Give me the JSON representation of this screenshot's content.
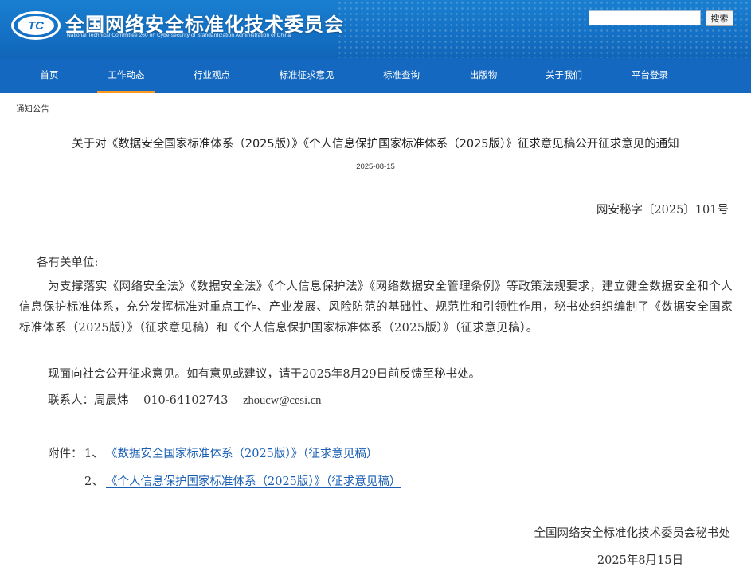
{
  "header": {
    "logo_text": "TC",
    "site_title": "全国网络安全标准化技术委员会",
    "site_subtitle": "National Technical Committee 260 on Cybersecurity of Standardization Administration of China",
    "search_placeholder": "",
    "search_button": "搜索"
  },
  "nav": {
    "items": [
      {
        "label": "首页"
      },
      {
        "label": "工作动态",
        "active": true
      },
      {
        "label": "行业观点"
      },
      {
        "label": "标准征求意见"
      },
      {
        "label": "标准查询"
      },
      {
        "label": "出版物"
      },
      {
        "label": "关于我们"
      },
      {
        "label": "平台登录"
      }
    ],
    "active_color": "#ff9a1e"
  },
  "breadcrumb": "通知公告",
  "article": {
    "title": "关于对《数据安全国家标准体系（2025版）》《个人信息保护国家标准体系（2025版）》征求意见稿公开征求意见的通知",
    "date": "2025-08-15",
    "doc_number": "网安秘字〔2025〕101号",
    "salutation": "各有关单位:",
    "paragraph1": "为支撑落实《网络安全法》《数据安全法》《个人信息保护法》《网络数据安全管理条例》等政策法规要求，建立健全数据安全和个人信息保护标准体系，充分发挥标准对重点工作、产业发展、风险防范的基础性、规范性和引领性作用，秘书处组织编制了《数据安全国家标准体系（2025版）》（征求意见稿）和《个人信息保护国家标准体系（2025版）》（征求意见稿）。",
    "paragraph2": "现面向社会公开征求意见。如有意见或建议，请于2025年8月29日前反馈至秘书处。",
    "contact": {
      "label": "联系人：周晨炜",
      "phone": "010-64102743",
      "email": "zhoucw@cesi.cn"
    },
    "attachments": {
      "label": "附件：",
      "items": [
        {
          "num": "1、",
          "title": "《数据安全国家标准体系（2025版）》（征求意见稿）"
        },
        {
          "num": "2、",
          "title": "《个人信息保护国家标准体系（2025版）》（征求意见稿）"
        }
      ]
    },
    "signature_org": "全国网络安全标准化技术委员会秘书处",
    "signature_date": "2025年8月15日"
  },
  "colors": {
    "header_blue": "#1470c4",
    "nav_blue": "#1568bf",
    "link_blue": "#1a5fb4"
  }
}
